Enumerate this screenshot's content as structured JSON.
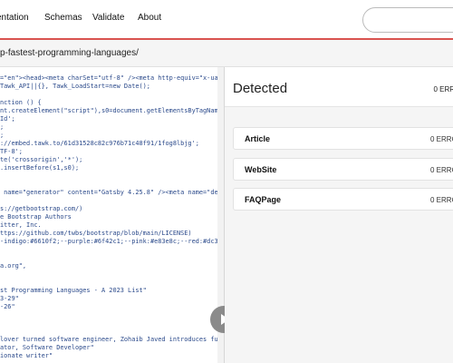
{
  "nav": {
    "items": [
      "entation",
      "Schemas",
      "Validate",
      "About"
    ],
    "search_placeholder": ""
  },
  "url": "p-fastest-programming-languages/",
  "code_lines": [
    "=\"en\"><head><meta charSet=\"utf-8\" /><meta http-equiv=\"x-ua-c",
    "Tawk_API||{}, Tawk_LoadStart=new Date();",
    "",
    "nction () {",
    "nt.createElement(\"script\"),s0=document.getElementsByTagName(",
    "Id';",
    ";",
    ";",
    "://embed.tawk.to/61d31528c82c976b71c48f91/1fog8lbjg';",
    "TF-8';",
    "te('crossorigin','*');",
    ".insertBefore(s1,s0);",
    "",
    "",
    " name=\"generator\" content=\"Gatsby 4.25.8\" /><meta name=\"desc",
    "",
    "s://getbootstrap.com/)",
    "e Bootstrap Authors",
    "itter, Inc.",
    "ttps://github.com/twbs/bootstrap/blob/main/LICENSE)",
    "-indigo:#6610f2;--purple:#6f42c1;--pink:#e83e8c;--red:#dc354",
    "",
    "",
    "a.org\",",
    "",
    "",
    "st Programming Languages - A 2023 List\"",
    "3-29\"",
    "-26\"",
    "",
    "",
    "",
    "lover turned software engineer, Zohaib Javed introduces futu",
    "ator, Software Developer\"",
    "ionate writer\""
  ],
  "results": {
    "title": "Detected",
    "summary": "0 ERR",
    "items": [
      {
        "name": "Article",
        "count": "0 ERRO"
      },
      {
        "name": "WebSite",
        "count": "0 ERRO"
      },
      {
        "name": "FAQPage",
        "count": "0 ERRO"
      }
    ]
  }
}
